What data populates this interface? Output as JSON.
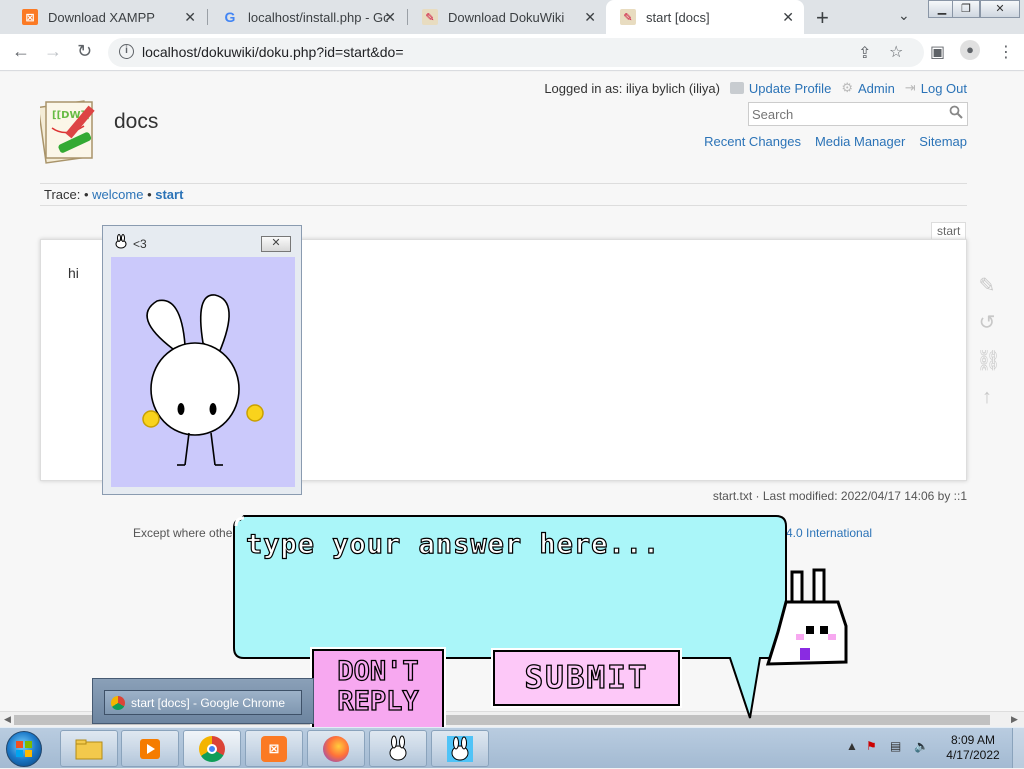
{
  "browser": {
    "tabs": [
      {
        "title": "Download XAMPP",
        "icon": "xampp-icon",
        "active": false
      },
      {
        "title": "localhost/install.php - Go",
        "icon": "google-icon",
        "active": false
      },
      {
        "title": "Download DokuWiki",
        "icon": "dokuwiki-icon",
        "active": false
      },
      {
        "title": "start [docs]",
        "icon": "dokuwiki-icon",
        "active": true
      }
    ],
    "url": "localhost/dokuwiki/doku.php?id=start&do="
  },
  "wiki": {
    "title": "docs",
    "user_tools": {
      "logged_in_label": "Logged in as: iliya bylich (iliya)",
      "update_profile": "Update Profile",
      "admin": "Admin",
      "logout": "Log Out"
    },
    "search_placeholder": "Search",
    "site_tools": [
      "Recent Changes",
      "Media Manager",
      "Sitemap"
    ],
    "breadcrumb": {
      "label": "Trace:",
      "items": [
        "welcome",
        "start"
      ]
    },
    "page_id": "start",
    "content": "hi",
    "doc_info": "start.txt · Last modified: 2022/04/17 14:06 by ::1",
    "license_left": "Except where othe",
    "license_right": "4.0 International"
  },
  "pet": {
    "window_title": "<3",
    "answer_placeholder": "type your answer here...",
    "dont_reply_line1": "DON'T",
    "dont_reply_line2": "REPLY",
    "submit_label": "SUBMIT",
    "bg_color": "#cbc9fb",
    "bubble_color": "#aaf6f9"
  },
  "taskbar": {
    "preview_title": "start [docs] - Google Chrome",
    "apps": [
      "folder-icon",
      "media-player-icon",
      "chrome-icon",
      "xampp-icon",
      "firefox-icon",
      "bunny-pet-icon",
      "bunny-pet-icon-2"
    ],
    "time": "8:09 AM",
    "date": "4/17/2022"
  }
}
